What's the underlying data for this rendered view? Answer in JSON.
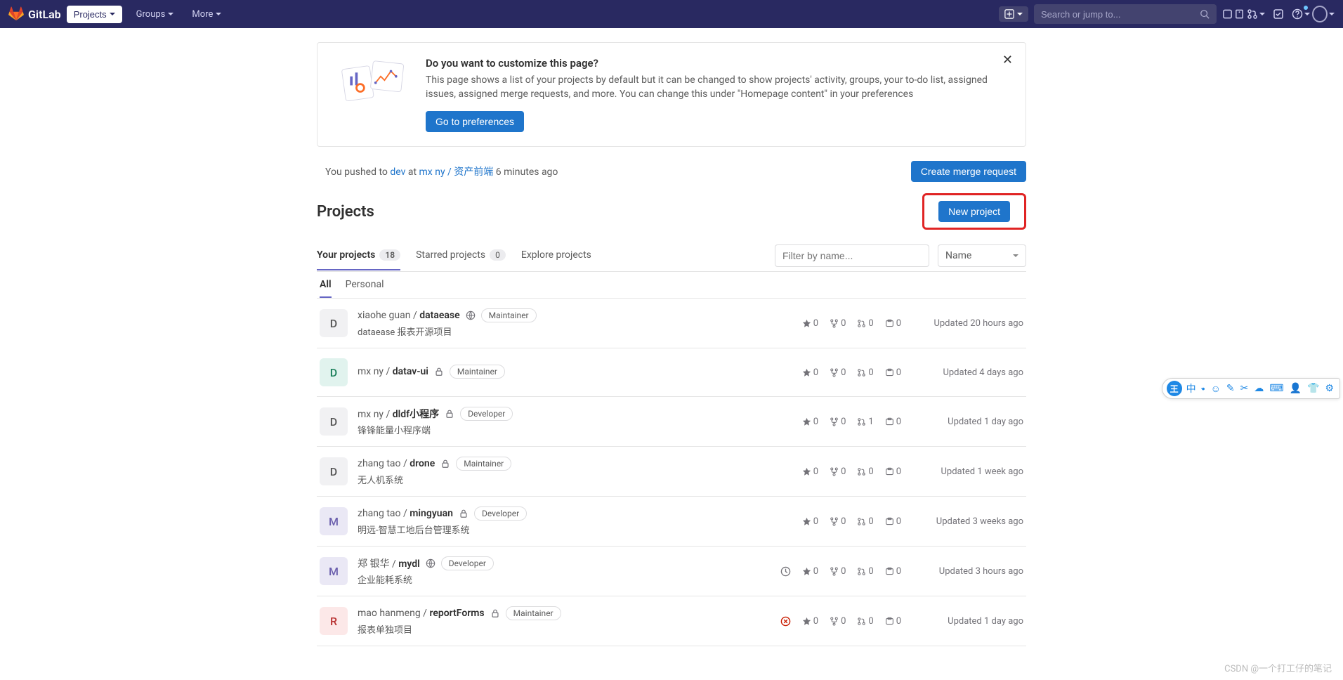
{
  "header": {
    "brand": "GitLab",
    "nav_projects": "Projects",
    "nav_groups": "Groups",
    "nav_more": "More",
    "search_placeholder": "Search or jump to..."
  },
  "banner": {
    "title": "Do you want to customize this page?",
    "body": "This page shows a list of your projects by default but it can be changed to show projects' activity, groups, your to-do list, assigned issues, assigned merge requests, and more. You can change this under \"Homepage content\" in your preferences",
    "button": "Go to preferences"
  },
  "push": {
    "prefix": "You pushed to ",
    "branch": "dev",
    "at": " at ",
    "project": "mx ny / 资产前端",
    "time": " 6 minutes ago",
    "mr_button": "Create merge request"
  },
  "projects_header": {
    "title": "Projects",
    "new_button": "New project"
  },
  "tabs1": {
    "your": "Your projects",
    "your_count": "18",
    "starred": "Starred projects",
    "starred_count": "0",
    "explore": "Explore projects"
  },
  "filter": {
    "placeholder": "Filter by name...",
    "sort": "Name"
  },
  "tabs2": {
    "all": "All",
    "personal": "Personal"
  },
  "projects": [
    {
      "letter": "D",
      "avatarBg": "#f1f1f3",
      "avatarColor": "#555",
      "path": "xiaohe guan / ",
      "name": "dataease",
      "vis": "public",
      "role": "Maintainer",
      "desc": "dataease 报表开源项目",
      "stars": "0",
      "forks": "0",
      "mrs": "0",
      "issues": "0",
      "updated": "Updated 20 hours ago",
      "warn": ""
    },
    {
      "letter": "D",
      "avatarBg": "#e1f3ee",
      "avatarColor": "#1a7f5a",
      "path": "mx ny / ",
      "name": "datav-ui",
      "vis": "private",
      "role": "Maintainer",
      "desc": "",
      "stars": "0",
      "forks": "0",
      "mrs": "0",
      "issues": "0",
      "updated": "Updated 4 days ago",
      "warn": ""
    },
    {
      "letter": "D",
      "avatarBg": "#f1f1f3",
      "avatarColor": "#555",
      "path": "mx ny / ",
      "name": "dldf小程序",
      "vis": "private",
      "role": "Developer",
      "desc": "锋锋能量小程序端",
      "stars": "0",
      "forks": "0",
      "mrs": "1",
      "issues": "0",
      "updated": "Updated 1 day ago",
      "warn": ""
    },
    {
      "letter": "D",
      "avatarBg": "#f1f1f3",
      "avatarColor": "#555",
      "path": "zhang tao / ",
      "name": "drone",
      "vis": "private",
      "role": "Maintainer",
      "desc": "无人机系统",
      "stars": "0",
      "forks": "0",
      "mrs": "0",
      "issues": "0",
      "updated": "Updated 1 week ago",
      "warn": ""
    },
    {
      "letter": "M",
      "avatarBg": "#eae8f5",
      "avatarColor": "#6b5fad",
      "path": "zhang tao / ",
      "name": "mingyuan",
      "vis": "private",
      "role": "Developer",
      "desc": "明远-智慧工地后台管理系统",
      "stars": "0",
      "forks": "0",
      "mrs": "0",
      "issues": "0",
      "updated": "Updated 3 weeks ago",
      "warn": ""
    },
    {
      "letter": "M",
      "avatarBg": "#eae8f5",
      "avatarColor": "#6b5fad",
      "path": "郑 银华 / ",
      "name": "mydl",
      "vis": "public",
      "role": "Developer",
      "desc": "企业能耗系统",
      "stars": "0",
      "forks": "0",
      "mrs": "0",
      "issues": "0",
      "updated": "Updated 3 hours ago",
      "warn": "clock"
    },
    {
      "letter": "R",
      "avatarBg": "#fce8e8",
      "avatarColor": "#b83232",
      "path": "mao hanmeng / ",
      "name": "reportForms",
      "vis": "private",
      "role": "Maintainer",
      "desc": "报表单独项目",
      "stars": "0",
      "forks": "0",
      "mrs": "0",
      "issues": "0",
      "updated": "Updated 1 day ago",
      "warn": "error"
    }
  ],
  "watermark": "CSDN @一个打工仔的笔记"
}
